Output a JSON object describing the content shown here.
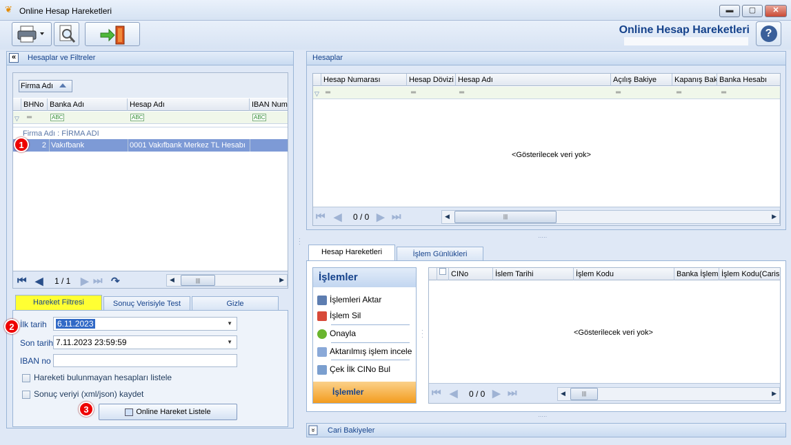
{
  "window": {
    "title": "Online Hesap Hareketleri",
    "btn_min": "▬",
    "btn_max": "▢",
    "btn_close": "✕"
  },
  "toolbar": {
    "app_title": "Online Hesap Hareketleri",
    "help": "?"
  },
  "left_panel": {
    "header": "Hesaplar ve Filtreler",
    "collapse": "«",
    "group_by": "Firma Adı",
    "columns": [
      "BHNo",
      "Banka Adı",
      "Hesap Adı",
      "IBAN Numa"
    ],
    "group_label": "Firma Adı : FİRMA ADI",
    "rows": [
      {
        "bhno": "2",
        "banka": "Vakıfbank",
        "hesap": "0001 Vakıfbank Merkez TL Hesabı",
        "iban": ""
      }
    ],
    "pager": "1 / 1",
    "filter_abc": "ABC"
  },
  "filter_tabs": [
    "Hareket Filtresi",
    "Sonuç Verisiyle Test",
    "Gizle"
  ],
  "filter_form": {
    "ilk_tarih_label": "İlk tarih",
    "ilk_tarih_value": "6.11.2023",
    "son_tarih_label": "Son tarih",
    "son_tarih_value": "7.11.2023 23:59:59",
    "iban_label": "IBAN no",
    "iban_value": "",
    "check1": "Hareketi bulunmayan hesapları listele",
    "check2": "Sonuç veriyi (xml/json) kaydet",
    "list_button": "Online Hareket Listele"
  },
  "badges": {
    "b1": "1",
    "b2": "2",
    "b3": "3"
  },
  "accounts_panel": {
    "header": "Hesaplar",
    "columns": [
      "Hesap Numarası",
      "Hesap Dövizi",
      "Hesap Adı",
      "Açılış Bakiye",
      "Kapanış Baki",
      "Banka Hesabı"
    ],
    "empty": "<Gösterilecek veri yok>",
    "pager": "0 / 0"
  },
  "movement_tabs": [
    "Hesap Hareketleri",
    "İşlem Günlükleri"
  ],
  "actions": {
    "title": "İşlemler",
    "items": [
      "İşlemleri Aktar",
      "İşlem Sil",
      "Onayla",
      "Aktarılmış işlem incele",
      "Çek İlk CINo Bul"
    ],
    "footer": "İşlemler"
  },
  "movements_grid": {
    "columns": [
      "CINo",
      "İslem Tarihi",
      "İşlem Kodu",
      "Banka İşlemi",
      "İşlem Kodu(Carisi"
    ],
    "empty": "<Gösterilecek veri yok>",
    "pager": "0 / 0"
  },
  "bottom_bar": {
    "label": "Cari Bakiyeler",
    "expand": "»"
  },
  "colors": {
    "accent": "#15428b",
    "selected_row": "#7d9ad6",
    "active_tab": "#ffff33",
    "actions_footer": "#f9a534"
  }
}
